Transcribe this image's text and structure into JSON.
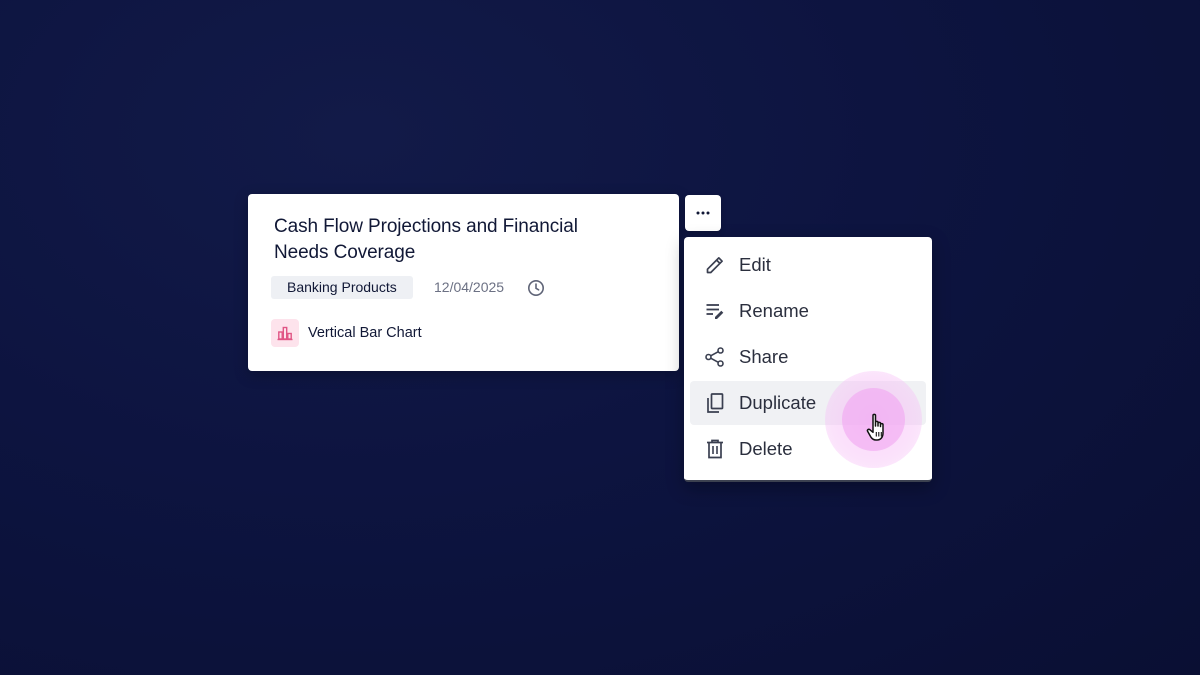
{
  "card": {
    "title": "Cash Flow Projections and Financial Needs Coverage",
    "tag": "Banking Products",
    "date": "12/04/2025",
    "date_icon": "clock-icon",
    "chart_type_icon": "bar-chart-icon",
    "chart_type_label": "Vertical Bar Chart"
  },
  "more_button": {
    "icon": "more-horizontal-icon"
  },
  "menu": {
    "items": [
      {
        "label": "Edit",
        "icon": "pencil-icon"
      },
      {
        "label": "Rename",
        "icon": "rename-icon"
      },
      {
        "label": "Share",
        "icon": "share-icon"
      },
      {
        "label": "Duplicate",
        "icon": "copy-icon",
        "active": true
      },
      {
        "label": "Delete",
        "icon": "trash-icon"
      }
    ]
  },
  "colors": {
    "background": "#0d1440",
    "card": "#ffffff",
    "title_text": "#111836",
    "muted_text": "#6c7184",
    "tag_bg": "#eef0f4",
    "chart_icon_bg": "#fde3ec",
    "chart_icon_stroke": "#e05585",
    "menu_hover": "#f0f1f4",
    "cursor_glow": "#f0a0f0"
  }
}
